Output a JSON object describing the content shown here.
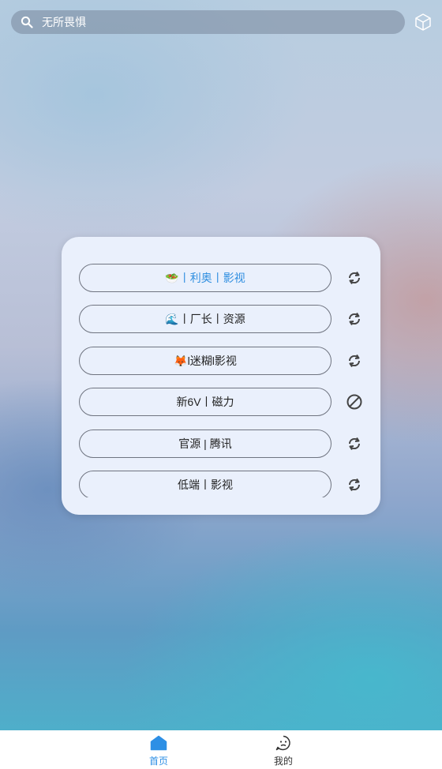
{
  "search": {
    "placeholder": "无所畏惧"
  },
  "sources": [
    {
      "label": "🥗丨利奥丨影视",
      "status": "refresh",
      "active": true
    },
    {
      "label": "🌊丨厂长丨资源",
      "status": "refresh",
      "active": false
    },
    {
      "label": "🦊l迷糊l影视",
      "status": "refresh",
      "active": false
    },
    {
      "label": "新6V丨磁力",
      "status": "disabled",
      "active": false
    },
    {
      "label": "官源 | 腾讯",
      "status": "refresh",
      "active": false
    },
    {
      "label": "低端丨影视",
      "status": "refresh",
      "active": false
    }
  ],
  "nav": {
    "home_label": "首页",
    "mine_label": "我的"
  },
  "colors": {
    "accent": "#2d8fe5",
    "card": "#eaf0fc"
  }
}
